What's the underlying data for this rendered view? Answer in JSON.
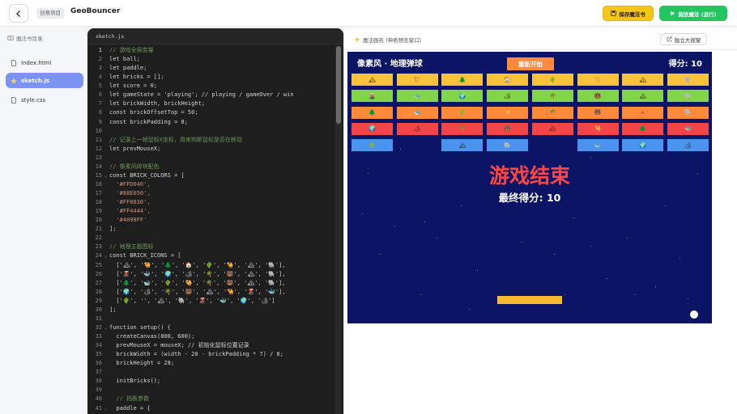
{
  "header": {
    "project_badge": "创意项目",
    "project_name": "GeoBouncer",
    "save_label": "保存魔法书",
    "run_label": "施放魔法 (运行)"
  },
  "sidebar": {
    "title": "魔法书目录",
    "files": [
      {
        "name": "index.html",
        "icon": "html-file-icon",
        "active": false
      },
      {
        "name": "sketch.js",
        "icon": "star-icon",
        "active": true
      },
      {
        "name": "style.css",
        "icon": "css-file-icon",
        "active": false
      }
    ]
  },
  "editor": {
    "tab": "sketch.js",
    "current_line": 1,
    "lines": [
      {
        "n": "1",
        "text": "// 游戏全局变量",
        "fold": false
      },
      {
        "n": "2",
        "text": "let ball;",
        "fold": false
      },
      {
        "n": "3",
        "text": "let paddle;",
        "fold": false
      },
      {
        "n": "4",
        "text": "let bricks = [];",
        "fold": false
      },
      {
        "n": "5",
        "text": "let score = 0;",
        "fold": false
      },
      {
        "n": "6",
        "text": "let gameState = 'playing'; // playing / gameOver / win",
        "fold": false
      },
      {
        "n": "7",
        "text": "let brickWidth, brickHeight;",
        "fold": false
      },
      {
        "n": "8",
        "text": "const brickOffsetTop = 50;",
        "fold": false
      },
      {
        "n": "9",
        "text": "const brickPadding = 8;",
        "fold": false
      },
      {
        "n": "10",
        "text": "",
        "fold": false
      },
      {
        "n": "11",
        "text": "// 记录上一帧鼠标X坐标，用来判断鼠标是否在移动",
        "fold": false
      },
      {
        "n": "12",
        "text": "let prevMouseX;",
        "fold": false
      },
      {
        "n": "13",
        "text": "",
        "fold": false
      },
      {
        "n": "14",
        "text": "// 像素风砖块配色",
        "fold": false
      },
      {
        "n": "15",
        "text": "const BRICK_COLORS = [",
        "fold": true
      },
      {
        "n": "16",
        "text": "  '#FFD040',",
        "fold": false
      },
      {
        "n": "17",
        "text": "  '#88E050',",
        "fold": false
      },
      {
        "n": "18",
        "text": "  '#FF8830',",
        "fold": false
      },
      {
        "n": "19",
        "text": "  '#FF4444',",
        "fold": false
      },
      {
        "n": "20",
        "text": "  '#4098FF'",
        "fold": false
      },
      {
        "n": "21",
        "text": "];",
        "fold": false
      },
      {
        "n": "22",
        "text": "",
        "fold": false
      },
      {
        "n": "23",
        "text": "// 地理主题图标",
        "fold": false
      },
      {
        "n": "24",
        "text": "const BRICK_ICONS = [",
        "fold": true
      },
      {
        "n": "25",
        "text": "  ['🏔', '🐫', '🌲', '🏠', '🌵', '🐪', '🏔', '🐘'],",
        "fold": false
      },
      {
        "n": "26",
        "text": "  ['🌋', '🐳', '🌍', '🏕', '🌴', '🐻', '🏔', '🐘'],",
        "fold": false
      },
      {
        "n": "27",
        "text": "  ['🌲', '🐋', '🌵', '🐫', '🌴', '🐻', '🏔', '🐘'],",
        "fold": false
      },
      {
        "n": "28",
        "text": "  ['🌍', '🏕', '🌴', '🐻', '🏔', '🐪', '🌋', '🐳'],",
        "fold": false
      },
      {
        "n": "29",
        "text": "  ['🌵', '', '🏔', '🐘', '🌋', '🐳', '🌍', '🏕']",
        "fold": false
      },
      {
        "n": "30",
        "text": "];",
        "fold": false
      },
      {
        "n": "31",
        "text": "",
        "fold": false
      },
      {
        "n": "32",
        "text": "function setup() {",
        "fold": true
      },
      {
        "n": "33",
        "text": "  createCanvas(800, 600);",
        "fold": false
      },
      {
        "n": "34",
        "text": "  prevMouseX = mouseX; // 初始化鼠标位置记录",
        "fold": false
      },
      {
        "n": "35",
        "text": "  brickWidth = (width - 20 - brickPadding * 7) / 8;",
        "fold": false
      },
      {
        "n": "36",
        "text": "  brickHeight = 28;",
        "fold": false
      },
      {
        "n": "37",
        "text": "",
        "fold": false
      },
      {
        "n": "38",
        "text": "  initBricks();",
        "fold": false
      },
      {
        "n": "39",
        "text": "",
        "fold": false
      },
      {
        "n": "40",
        "text": "  // 挡板参数",
        "fold": false
      },
      {
        "n": "41",
        "text": "  paddle = {",
        "fold": true
      }
    ]
  },
  "preview": {
    "title": "魔法画布 (神奇预览窗口)",
    "fullscreen_label": "独立大视窗"
  },
  "game": {
    "title": "像素风 · 地理弹球",
    "restart_label": "重新开始",
    "score_label": "得分: 10",
    "game_over": "游戏结束",
    "final_score": "最终得分: 10",
    "colors": {
      "bg": "#0c1466",
      "row1": "#F8C33A",
      "row2": "#82D54A",
      "row3": "#FF8A3A",
      "row4": "#F24545",
      "row5": "#4A94F0"
    },
    "brick_rows": [
      [
        "🏔",
        "🐫",
        "🌲",
        "🏠",
        "🌵",
        "🐪",
        "🏔",
        "🐘"
      ],
      [
        "🌋",
        "🐳",
        "🌍",
        "🏕",
        "🌴",
        "🐻",
        "🏔",
        "🐘"
      ],
      [
        "🌲",
        "🐋",
        "🌵",
        "🐫",
        "🌴",
        "🐻",
        "🔺",
        "🐘"
      ],
      [
        "🌍",
        "🏕",
        "🌴",
        "🐻",
        "🏔",
        "🐪",
        "🌲",
        "🐳"
      ],
      [
        "🌵",
        null,
        "🏔",
        "🐘",
        null,
        "🐳",
        "🌍",
        "🏕"
      ]
    ]
  }
}
